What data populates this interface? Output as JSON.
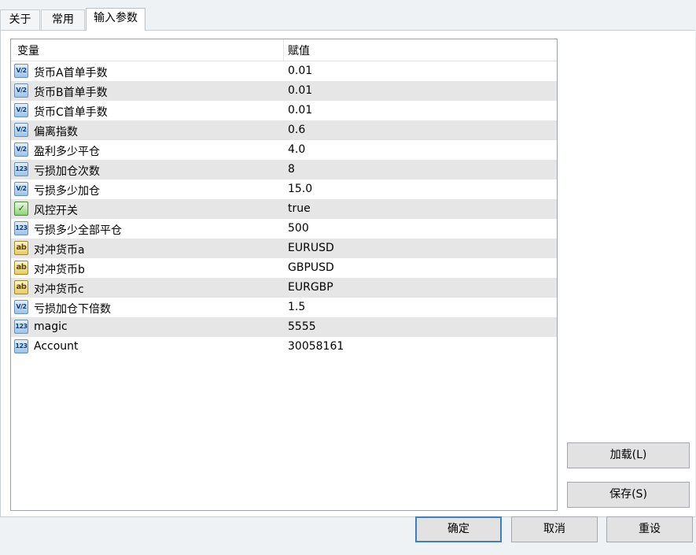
{
  "tabs": [
    {
      "label": "关于"
    },
    {
      "label": "常用"
    },
    {
      "label": "输入参数",
      "active": true
    }
  ],
  "table": {
    "headers": {
      "variable": "变量",
      "value": "赋值"
    },
    "rows": [
      {
        "icon": "double-icon",
        "icon_text": "V/2",
        "name": "货币A首单手数",
        "value": "0.01"
      },
      {
        "icon": "double-icon",
        "icon_text": "V/2",
        "name": "货币B首单手数",
        "value": "0.01"
      },
      {
        "icon": "double-icon",
        "icon_text": "V/2",
        "name": "货币C首单手数",
        "value": "0.01"
      },
      {
        "icon": "double-icon",
        "icon_text": "V/2",
        "name": "偏离指数",
        "value": "0.6"
      },
      {
        "icon": "double-icon",
        "icon_text": "V/2",
        "name": "盈利多少平仓",
        "value": "4.0"
      },
      {
        "icon": "integer-icon",
        "icon_text": "123",
        "name": "亏损加仓次数",
        "value": "8"
      },
      {
        "icon": "double-icon",
        "icon_text": "V/2",
        "name": "亏损多少加仓",
        "value": "15.0"
      },
      {
        "icon": "bool-icon",
        "icon_text": "✓",
        "name": "风控开关",
        "value": "true"
      },
      {
        "icon": "integer-icon",
        "icon_text": "123",
        "name": "亏损多少全部平仓",
        "value": "500"
      },
      {
        "icon": "string-icon",
        "icon_text": "ab",
        "name": "对冲货币a",
        "value": "EURUSD"
      },
      {
        "icon": "string-icon",
        "icon_text": "ab",
        "name": "对冲货币b",
        "value": "GBPUSD"
      },
      {
        "icon": "string-icon",
        "icon_text": "ab",
        "name": "对冲货币c",
        "value": "EURGBP"
      },
      {
        "icon": "double-icon",
        "icon_text": "V/2",
        "name": "亏损加仓下倍数",
        "value": "1.5"
      },
      {
        "icon": "integer-icon",
        "icon_text": "123",
        "name": "magic",
        "value": "5555"
      },
      {
        "icon": "integer-icon",
        "icon_text": "123",
        "name": "Account",
        "value": "30058161"
      }
    ]
  },
  "side_buttons": {
    "load": "加载(L)",
    "save": "保存(S)"
  },
  "bottom_buttons": {
    "ok": "确定",
    "cancel": "取消",
    "reset": "重设"
  }
}
